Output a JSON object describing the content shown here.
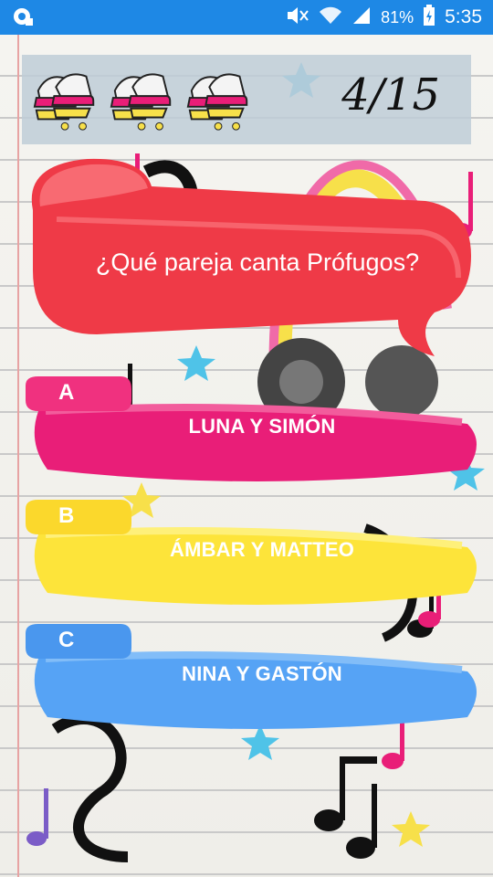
{
  "status_bar": {
    "battery": "81%",
    "time": "5:35"
  },
  "header": {
    "lives_icon": "roller-skate-icon",
    "lives_count": 3,
    "progress": "4/15"
  },
  "question": {
    "text": "¿Qué pareja canta Prófugos?"
  },
  "answers": [
    {
      "letter": "A",
      "label": "LUNA Y SIMÓN",
      "color": "#e91e78",
      "tab_color": "#f0317f"
    },
    {
      "letter": "B",
      "label": "ÁMBAR Y MATTEO",
      "color": "#fde43a",
      "tab_color": "#fbd82c"
    },
    {
      "letter": "C",
      "label": "NINA Y GASTÓN",
      "color": "#56a3f5",
      "tab_color": "#4a97ee"
    }
  ],
  "colors": {
    "status_bar": "#1e88e5",
    "question_bubble": "#f4474f"
  }
}
